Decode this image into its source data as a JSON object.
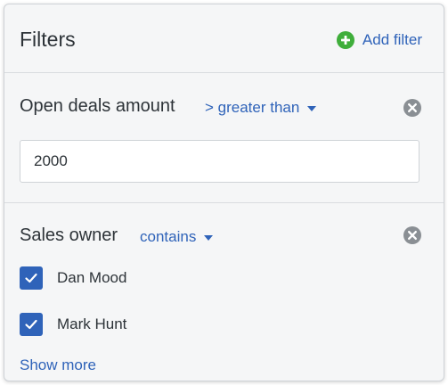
{
  "panel": {
    "title": "Filters",
    "add_filter_label": "Add filter"
  },
  "filters": [
    {
      "label": "Open deals amount",
      "operator": "> greater than",
      "value": "2000"
    },
    {
      "label": "Sales owner",
      "operator": "contains",
      "options": [
        {
          "label": "Dan Mood",
          "checked": true
        },
        {
          "label": "Mark Hunt",
          "checked": true
        }
      ],
      "show_more_label": "Show more"
    }
  ],
  "colors": {
    "link": "#2f63b9",
    "add_icon": "#3fae3b",
    "remove_icon": "#8a8f94",
    "checkbox": "#2f63b9",
    "panel_bg": "#f5f6f7"
  },
  "icons": {
    "add": "plus-circle-icon",
    "remove": "close-circle-icon",
    "operator_dropdown": "caret-down-icon",
    "checked": "checkmark-icon"
  }
}
